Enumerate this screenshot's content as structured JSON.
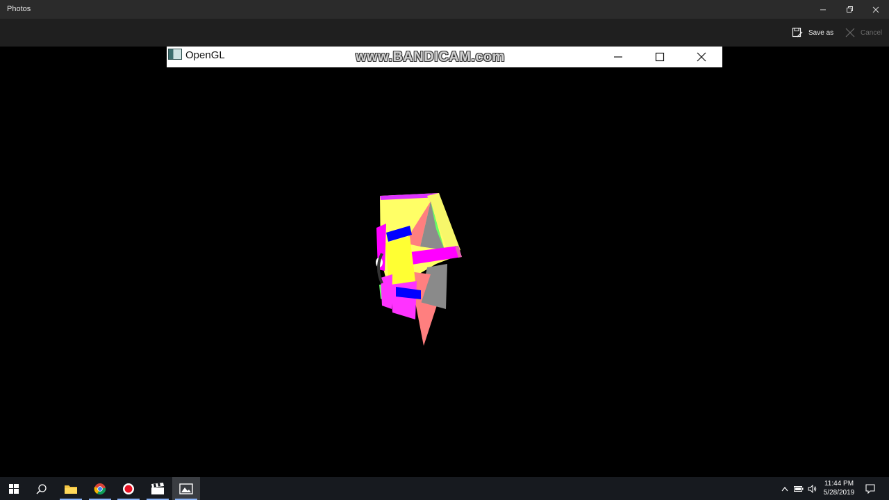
{
  "app": {
    "title": "Photos",
    "window_controls": [
      "minimize-icon",
      "restore-icon",
      "close-icon"
    ]
  },
  "commandbar": {
    "save_as_label": "Save as",
    "cancel_label": "Cancel"
  },
  "opengl_window": {
    "title": "OpenGL",
    "watermark": "www.BANDICAM.com"
  },
  "taskbar": {
    "apps": [
      "start-icon",
      "search-icon",
      "file-explorer-icon",
      "chrome-icon",
      "record-icon",
      "video-editor-icon",
      "photos-icon"
    ],
    "time": "11:44 PM",
    "date": "5/28/2019"
  },
  "colors": {
    "yellow": "#ffff66",
    "magenta": "#ff00ff",
    "salmon": "#ff7f7f",
    "gray": "#8c8c8c",
    "green": "#66ff66",
    "blue": "#0000ff"
  }
}
